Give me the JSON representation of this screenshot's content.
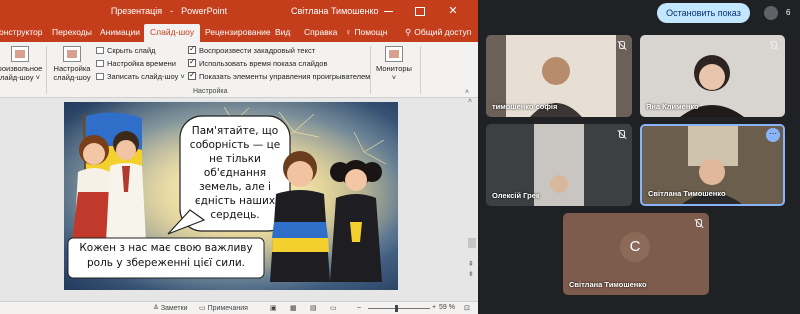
{
  "powerpoint": {
    "title": "Презентація",
    "app_name": "PowerPoint",
    "separator": "-",
    "user": "Світлана Тимошенко",
    "accent_color": "#c43e1c",
    "tabs": [
      "онструктор",
      "Переходы",
      "Анимации",
      "Слайд-шоу",
      "Рецензирование",
      "Вид",
      "Справка",
      "Помощн",
      "Общий доступ"
    ],
    "active_tab_index": 3,
    "help_icon": "lightbulb-icon",
    "share_icon": "person-share-icon",
    "ribbon": {
      "record_slide_show": [
        "роизвольное",
        "лайд-шоу ˅"
      ],
      "setup_slide_show": [
        "Настройка",
        "слайд-шоу"
      ],
      "hide_slide": "Скрыть слайд",
      "rehearse_timings": "Настройка времени",
      "record_slide_show_small": "Записать слайд-шоу ˅",
      "play_narrations": "Воспроизвести закадровый текст",
      "use_timings": "Использовать время показа слайдов",
      "show_media_controls": "Показать элементы управления проигрывателем",
      "checkboxes_checked": [
        true,
        true,
        true
      ],
      "group_label": "Настройка",
      "monitors": [
        "Мониторы",
        "˅"
      ]
    },
    "slide": {
      "speech_bubble": "Пам'ятайте, що соборність — це не тільки об'єднання земель, але і єдність наших сердець.",
      "banner": "Кожен з нас має свою важливу роль у збереженні цієї сили.",
      "bg_colors": [
        "#f6e39a",
        "#4b6a8c",
        "#223a5c"
      ]
    },
    "status": {
      "notes": "Заметки",
      "comments": "Примечания",
      "zoom": "59 %",
      "zoom_fraction": 0.59
    }
  },
  "meet": {
    "stop_presenting": "Остановить показ",
    "participant_count": "6",
    "participants": [
      {
        "name": "тимошенко софія",
        "muted": true
      },
      {
        "name": "Яна Клименко",
        "muted": true
      },
      {
        "name": "Олексій Грек",
        "muted": true
      },
      {
        "name": "Світлана Тимошенко",
        "muted": false,
        "speaking": true
      },
      {
        "name": "Світлана Тимошенко",
        "muted": true,
        "avatar_letter": "C"
      }
    ],
    "more_options": "⋯",
    "highlight_color": "#8ab4f8"
  }
}
